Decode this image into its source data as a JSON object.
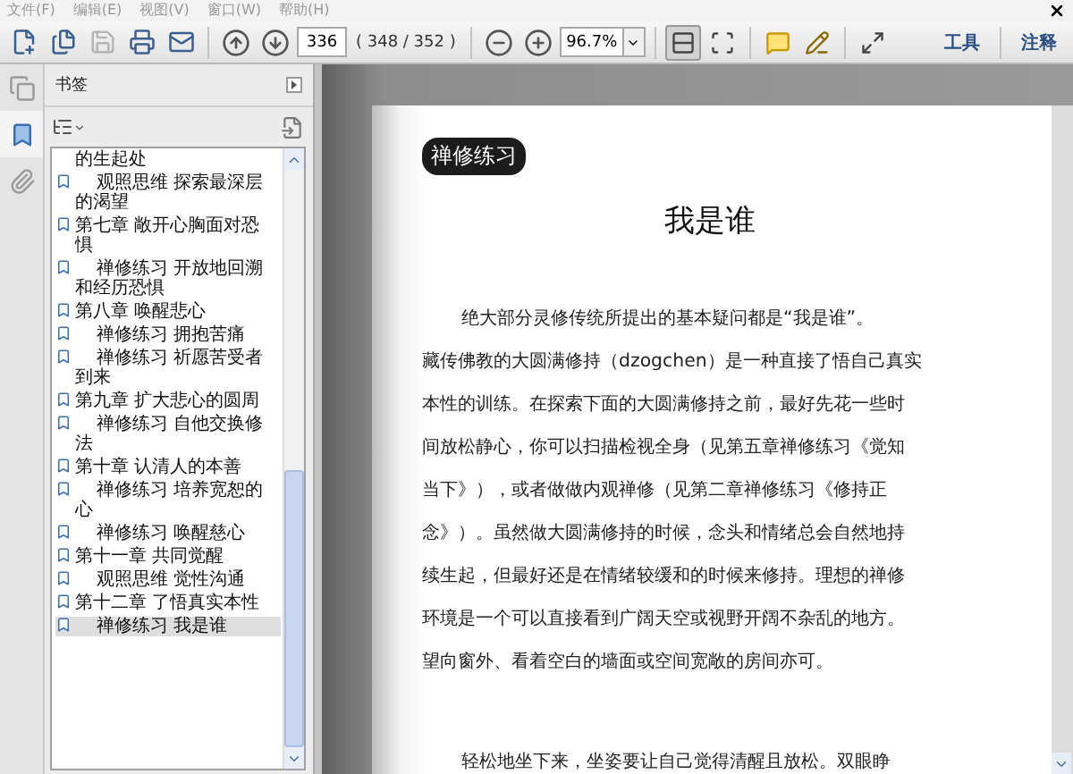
{
  "menu_bar": {
    "items": [
      "文件(F)",
      "编辑(E)",
      "视图(V)",
      "窗口(W)",
      "帮助(H)"
    ]
  },
  "toolbar": {
    "file_tools": [
      {
        "kind": "create",
        "disabled": false
      },
      {
        "kind": "combine",
        "disabled": false
      },
      {
        "kind": "save",
        "disabled": true
      },
      {
        "kind": "print",
        "disabled": false
      },
      {
        "kind": "email",
        "disabled": false
      }
    ],
    "page_number": "336",
    "page_count": "( 348 / 352 )",
    "zoom": "96.7%",
    "view_modes": [
      {
        "kind": "fit-page",
        "selected": true
      },
      {
        "kind": "fit-width",
        "selected": false
      }
    ],
    "right_links": [
      "工具",
      "注释"
    ]
  },
  "nav_tabs": [
    {
      "kind": "pages",
      "selected": false
    },
    {
      "kind": "bookmarks",
      "selected": true
    },
    {
      "kind": "attachments",
      "selected": false
    }
  ],
  "bookmarks": {
    "title": "书签",
    "items": [
      {
        "kind": "fragment",
        "label": "的生起处",
        "selected": false
      },
      {
        "kind": "practice",
        "label": "观照思维 探索最深层的渴望",
        "selected": false
      },
      {
        "kind": "chapter",
        "label": "第七章 敞开心胸面对恐惧",
        "selected": false
      },
      {
        "kind": "practice",
        "label": "禅修练习 开放地回溯和经历恐惧",
        "selected": false
      },
      {
        "kind": "chapter",
        "label": "第八章 唤醒悲心",
        "selected": false
      },
      {
        "kind": "practice",
        "label": "禅修练习 拥抱苦痛",
        "selected": false
      },
      {
        "kind": "practice",
        "label": "禅修练习 祈愿苦受者到来",
        "selected": false
      },
      {
        "kind": "chapter",
        "label": "第九章 扩大悲心的圆周",
        "selected": false
      },
      {
        "kind": "practice",
        "label": "禅修练习 自他交换修法",
        "selected": false
      },
      {
        "kind": "chapter",
        "label": "第十章 认清人的本善",
        "selected": false
      },
      {
        "kind": "practice",
        "label": "禅修练习 培养宽恕的心",
        "selected": false
      },
      {
        "kind": "practice",
        "label": "禅修练习 唤醒慈心",
        "selected": false
      },
      {
        "kind": "chapter",
        "label": "第十一章 共同觉醒",
        "selected": false
      },
      {
        "kind": "practice",
        "label": "观照思维 觉性沟通",
        "selected": false
      },
      {
        "kind": "chapter",
        "label": "第十二章 了悟真实本性",
        "selected": false
      },
      {
        "kind": "practice",
        "label": "禅修练习 我是谁",
        "selected": true
      }
    ]
  },
  "document": {
    "badge": "禅修练习",
    "title": "我是谁",
    "paragraphs": [
      [
        "绝大部分灵修传统所提出的基本疑问都是“我是谁”。",
        "藏传佛教的大圆满修持（dzogchen）是一种直接了悟自己真实",
        "本性的训练。在探索下面的大圆满修持之前，最好先花一些时",
        "间放松静心，你可以扫描检视全身（见第五章禅修练习《觉知",
        "当下》），或者做做内观禅修（见第二章禅修练习《修持正",
        "念》）。虽然做大圆满修持的时候，念头和情绪总会自然地持",
        "续生起，但最好还是在情绪较缓和的时候来修持。理想的禅修",
        "环境是一个可以直接看到广阔天空或视野开阔不杂乱的地方。",
        "望向窗外、看着空白的墙面或空间宽敞的房间亦可。"
      ],
      [
        "轻松地坐下来，坐姿要让自己觉得清醒且放松。双眼睁"
      ]
    ]
  }
}
